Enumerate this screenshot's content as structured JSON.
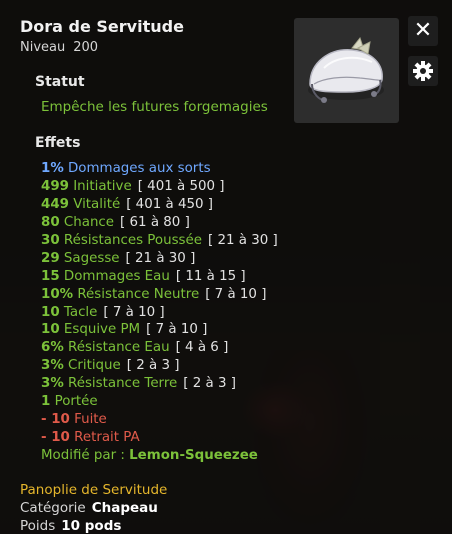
{
  "item": {
    "name": "Dora de Servitude",
    "level_label": "Niveau",
    "level_value": "200"
  },
  "controls": {
    "close_icon": "close-icon",
    "settings_icon": "gear-icon"
  },
  "statut": {
    "heading": "Statut",
    "text": "Empêche les futures forgemagies"
  },
  "effects": {
    "heading": "Effets",
    "lines": [
      {
        "value": "1%",
        "label": "Dommages aux sorts",
        "range": "",
        "color": "#6fa8ff"
      },
      {
        "value": "499",
        "label": "Initiative",
        "range": "[ 401 à 500 ]",
        "color": "#7cc23a"
      },
      {
        "value": "449",
        "label": "Vitalité",
        "range": "[ 401 à 450 ]",
        "color": "#7cc23a"
      },
      {
        "value": "80",
        "label": "Chance",
        "range": "[ 61 à 80 ]",
        "color": "#7cc23a"
      },
      {
        "value": "30",
        "label": "Résistances Poussée",
        "range": "[ 21 à 30 ]",
        "color": "#7cc23a"
      },
      {
        "value": "29",
        "label": "Sagesse",
        "range": "[ 21 à 30 ]",
        "color": "#7cc23a"
      },
      {
        "value": "15",
        "label": "Dommages Eau",
        "range": "[ 11 à 15 ]",
        "color": "#7cc23a"
      },
      {
        "value": "10%",
        "label": "Résistance Neutre",
        "range": "[ 7 à 10 ]",
        "color": "#7cc23a"
      },
      {
        "value": "10",
        "label": "Tacle",
        "range": "[ 7 à 10 ]",
        "color": "#7cc23a"
      },
      {
        "value": "10",
        "label": "Esquive PM",
        "range": "[ 7 à 10 ]",
        "color": "#7cc23a"
      },
      {
        "value": "6%",
        "label": "Résistance Eau",
        "range": "[ 4 à 6 ]",
        "color": "#7cc23a"
      },
      {
        "value": "3%",
        "label": "Critique",
        "range": "[ 2 à 3 ]",
        "color": "#7cc23a"
      },
      {
        "value": "3%",
        "label": "Résistance Terre",
        "range": "[ 2 à 3 ]",
        "color": "#7cc23a"
      },
      {
        "value": "1",
        "label": "Portée",
        "range": "",
        "color": "#7cc23a"
      },
      {
        "value": "- 10",
        "label": "Fuite",
        "range": "",
        "color": "#e05a4a"
      },
      {
        "value": "- 10",
        "label": "Retrait PA",
        "range": "",
        "color": "#e05a4a"
      }
    ],
    "modified_by_label": "Modifié par :",
    "modified_by_name": "Lemon-Squeezee"
  },
  "footer": {
    "set_name": "Panoplie de Servitude",
    "category_label": "Catégorie",
    "category_value": "Chapeau",
    "weight_label": "Poids",
    "weight_value": "10 pods"
  }
}
